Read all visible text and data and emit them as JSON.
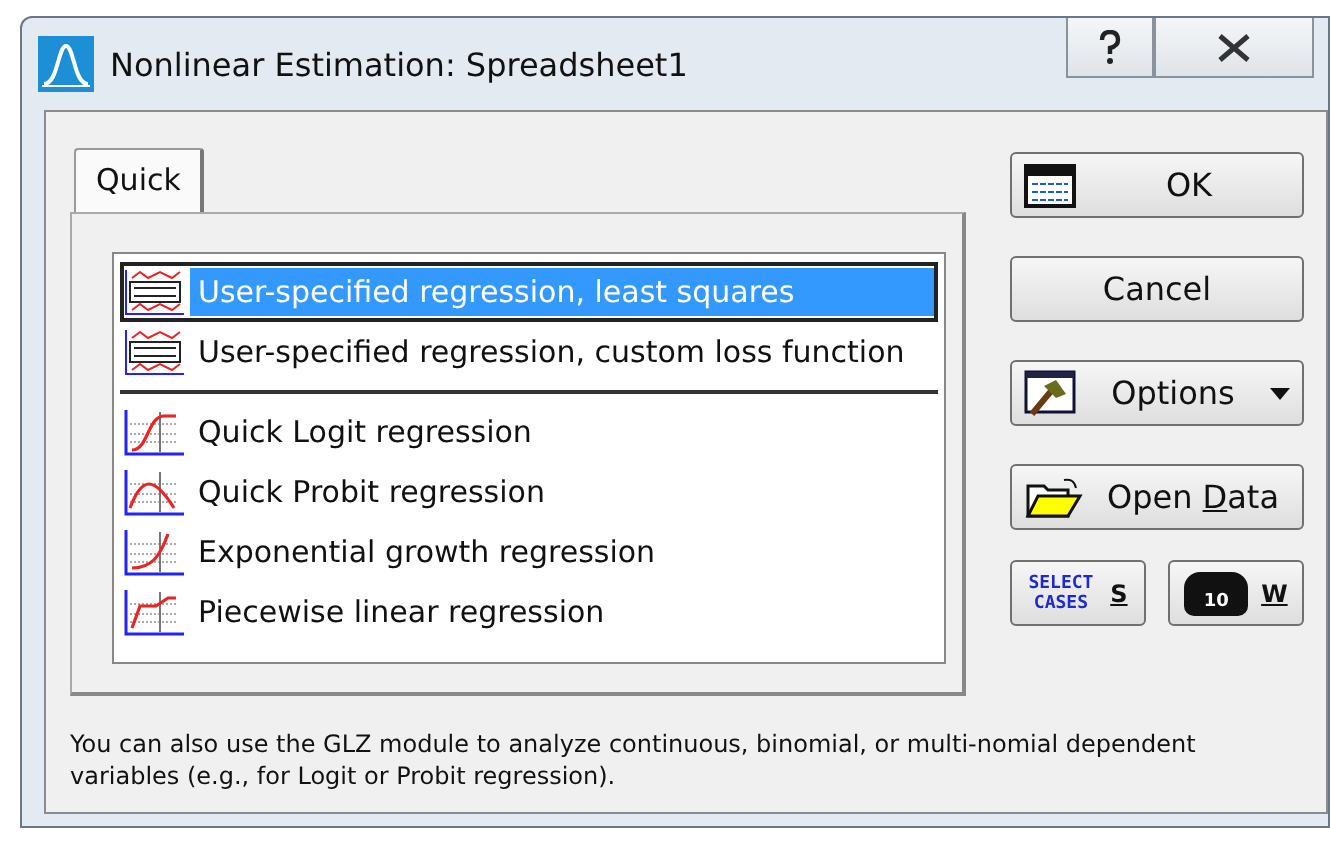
{
  "window": {
    "title": "Nonlinear Estimation: Spreadsheet1",
    "controls": [
      {
        "kind": "help"
      },
      {
        "kind": "close"
      }
    ]
  },
  "tabs": [
    {
      "label": "Quick",
      "selected": true
    }
  ],
  "analysis_list": [
    {
      "kind": "user",
      "label": "User-specified regression, least squares",
      "selected": true
    },
    {
      "kind": "user",
      "label": "User-specified regression, custom loss function",
      "selected": false
    },
    {
      "kind": "separator"
    },
    {
      "kind": "logit",
      "label": "Quick Logit regression",
      "selected": false
    },
    {
      "kind": "probit",
      "label": "Quick Probit regression",
      "selected": false
    },
    {
      "kind": "exponential",
      "label": "Exponential growth regression",
      "selected": false
    },
    {
      "kind": "piecewise",
      "label": "Piecewise linear regression",
      "selected": false
    }
  ],
  "buttons": [
    {
      "kind": "ok",
      "label": "OK"
    },
    {
      "kind": "cancel",
      "label": "Cancel"
    },
    {
      "kind": "options",
      "label": "Options"
    },
    {
      "kind": "open",
      "before": "Open ",
      "accel": "D",
      "after": "ata"
    }
  ],
  "small_buttons": [
    {
      "kind": "select",
      "icon_text": [
        "SELECT",
        "CASES"
      ],
      "accel": "S"
    },
    {
      "kind": "weight",
      "icon_text": [
        "10"
      ],
      "accel": "W"
    }
  ],
  "note": "You can also use the GLZ module to analyze continuous, binomial, or multi-nomial dependent variables (e.g., for Logit or Probit regression)."
}
